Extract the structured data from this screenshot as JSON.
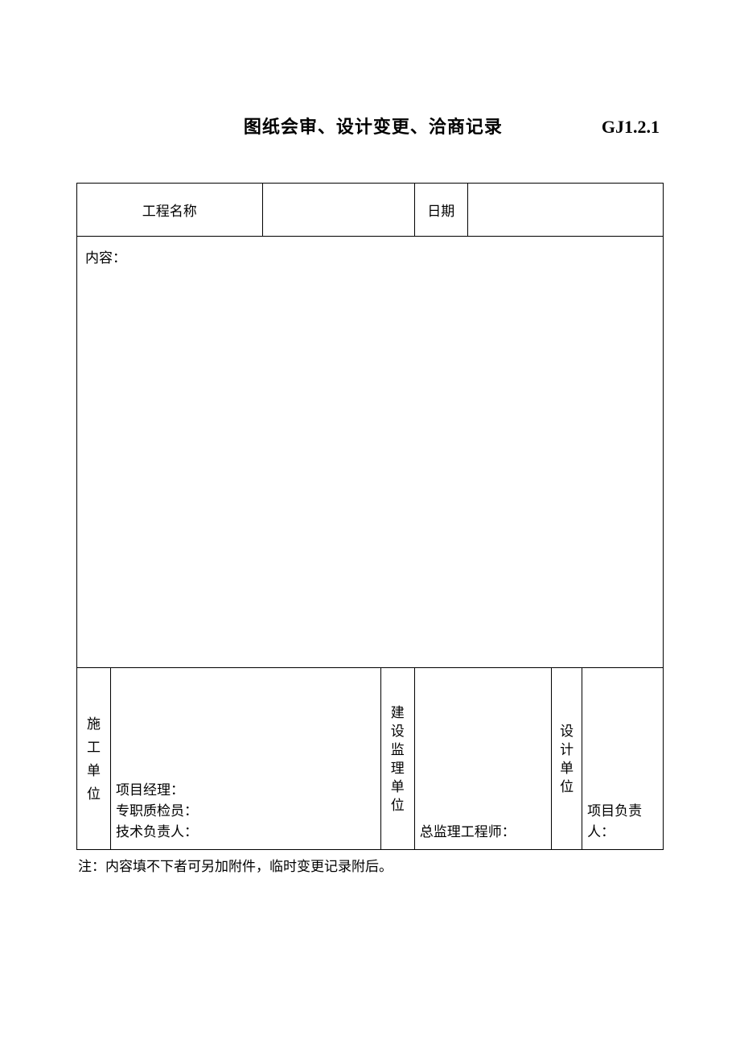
{
  "header": {
    "title": "图纸会审、设计变更、洽商记录",
    "code": "GJ1.2.1"
  },
  "row1": {
    "project_name_label": "工程名称",
    "project_name_value": "",
    "date_label": "日期",
    "date_value": ""
  },
  "content": {
    "label": "内容：",
    "value": ""
  },
  "signatures": {
    "construction_unit": {
      "label_chars": [
        "施",
        "工",
        "单",
        "位"
      ],
      "line1": "项目经理：",
      "line2": "专职质检员：",
      "line3": "技术负责人："
    },
    "supervision_unit": {
      "label_chars": [
        "建",
        "设",
        "监",
        "理",
        "单",
        "位"
      ],
      "line1": "总监理工程师："
    },
    "design_unit": {
      "label_chars": [
        "设",
        "计",
        "单",
        "位"
      ],
      "line1": "项目负责人："
    }
  },
  "note": "注：内容填不下者可另加附件，临时变更记录附后。"
}
